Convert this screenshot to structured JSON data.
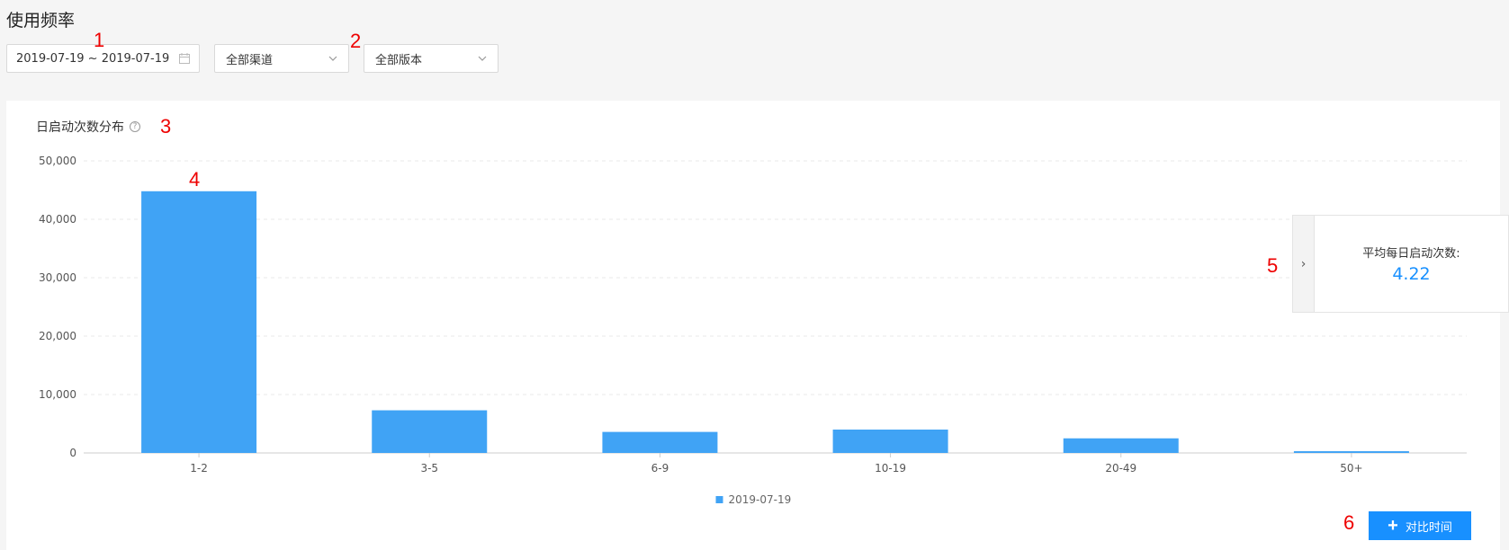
{
  "page": {
    "title": "使用频率"
  },
  "filters": {
    "date_range": "2019-07-19 ~ 2019-07-19",
    "channel": "全部渠道",
    "version": "全部版本"
  },
  "annotations": [
    "1",
    "2",
    "3",
    "4",
    "5",
    "6"
  ],
  "card": {
    "title": "日启动次数分布"
  },
  "chart_data": {
    "type": "bar",
    "title": "日启动次数分布",
    "categories": [
      "1-2",
      "3-5",
      "6-9",
      "10-19",
      "20-49",
      "50+"
    ],
    "series": [
      {
        "name": "2019-07-19",
        "values": [
          44800,
          7300,
          3600,
          4000,
          2500,
          300
        ]
      }
    ],
    "ylim": [
      0,
      50000
    ],
    "yticks": [
      "0",
      "10,000",
      "20,000",
      "30,000",
      "40,000",
      "50,000"
    ],
    "grid": true,
    "legend": "bottom",
    "color": "#40a3f5"
  },
  "summary": {
    "label": "平均每日启动次数:",
    "value": "4.22"
  },
  "actions": {
    "compare_label": "对比时间"
  }
}
